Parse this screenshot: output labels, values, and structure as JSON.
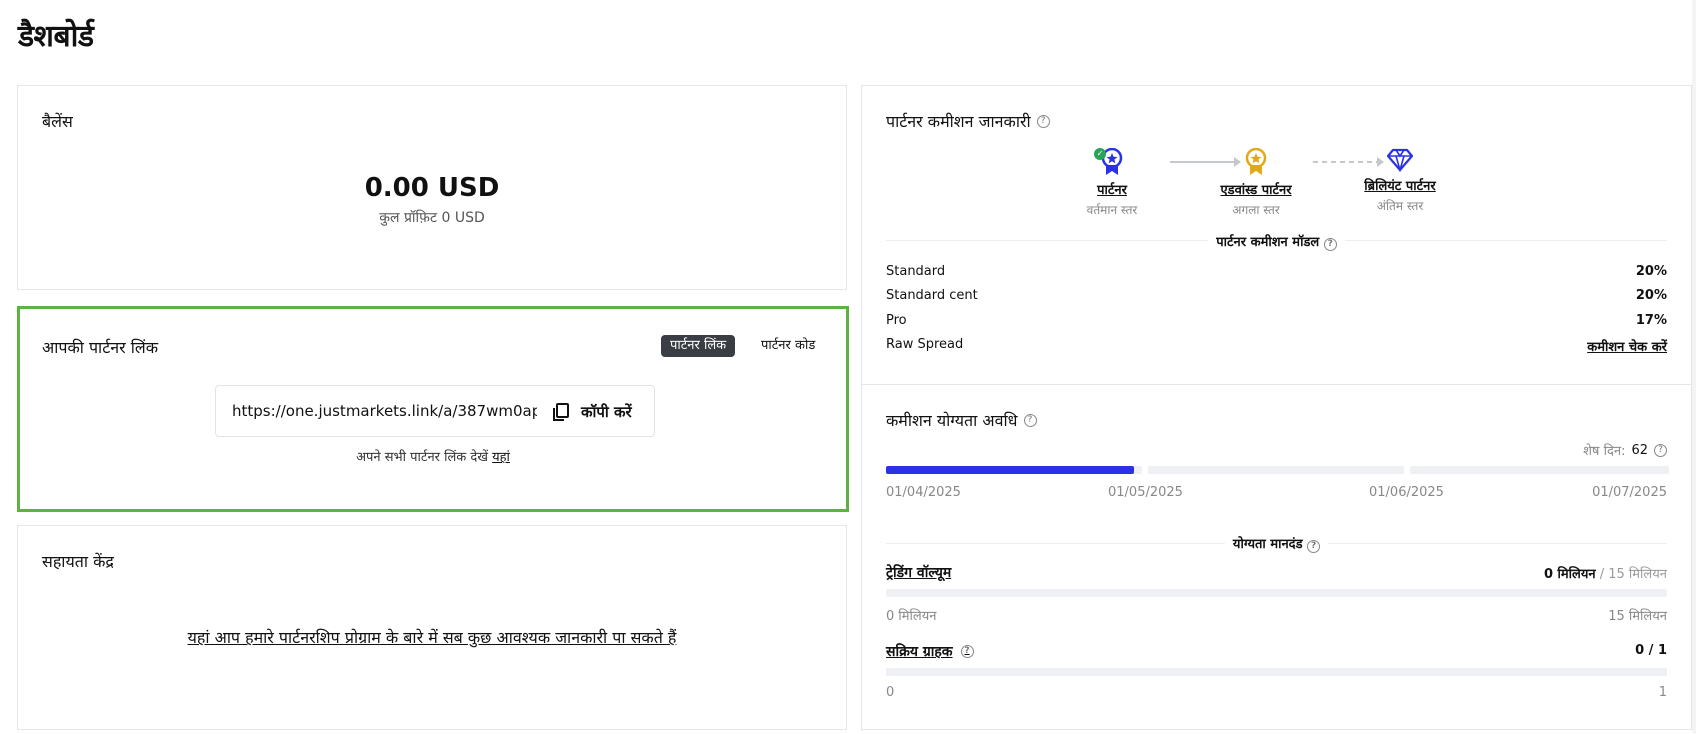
{
  "page": {
    "title": "डैशबोर्ड"
  },
  "balance": {
    "title": "बैलेंस",
    "amount": "0.00 USD",
    "profit_label": "कुल प्रॉफ़िट 0 USD"
  },
  "partner_link": {
    "title": "आपकी पार्टनर लिंक",
    "tabs": [
      {
        "label": "पार्टनर लिंक",
        "active": true
      },
      {
        "label": "पार्टनर कोड",
        "active": false
      }
    ],
    "url": "https://one.justmarkets.link/a/387wm0apih",
    "copy_label": "कॉपी करें",
    "note_prefix": "अपने सभी पार्टनर लिंक देखें",
    "note_link": "यहां"
  },
  "help_center": {
    "title": "सहायता केंद्र",
    "link_text": "यहां आप हमारे पार्टनरशिप प्रोग्राम के बारे में सब कुछ आवश्यक जानकारी पा सकते हैं"
  },
  "commission": {
    "title": "पार्टनर कमीशन जानकारी",
    "tiers": [
      {
        "name": "पार्टनर",
        "status": "वर्तमान स्तर",
        "icon": "ribbon-star-icon",
        "color": "#2b32e6"
      },
      {
        "name": "एडवांस्ड पार्टनर",
        "status": "अगला स्तर",
        "icon": "ribbon-star-icon",
        "color": "#e0a91b"
      },
      {
        "name": "ब्रिलियंट पार्टनर",
        "status": "अंतिम स्तर",
        "icon": "diamond-icon",
        "color": "#2b32e6"
      }
    ],
    "model_label": "पार्टनर कमीशन मॉडल",
    "rows": [
      {
        "label": "Standard",
        "value": "20%"
      },
      {
        "label": "Standard cent",
        "value": "20%"
      },
      {
        "label": "Pro",
        "value": "17%"
      },
      {
        "label": "Raw Spread",
        "value": "कमीशन चेक करें"
      }
    ]
  },
  "period": {
    "title": "कमीशन योग्यता अवधि",
    "days_left_label": "शेष दिन:",
    "days_left_value": "62",
    "progress_fraction": 0.97,
    "dates": [
      "01/04/2025",
      "01/05/2025",
      "01/06/2025",
      "01/07/2025"
    ],
    "criteria_label": "योग्यता मानदंड",
    "criteria": [
      {
        "name": "ट्रेडिंग वॉल्यूम",
        "current": "0 मिलियन",
        "target": " / 15 मिलियन",
        "min": "0 मिलियन",
        "max": "15 मिलियन",
        "progress": 0
      },
      {
        "name": "सक्रिय ग्राहक",
        "current": "0 / 1",
        "target": "",
        "min": "0",
        "max": "1",
        "progress": 0
      }
    ]
  },
  "colors": {
    "accent": "#2b32e6",
    "highlight_border": "#5fb144",
    "gold": "#e0a91b",
    "success": "#27a35a"
  }
}
